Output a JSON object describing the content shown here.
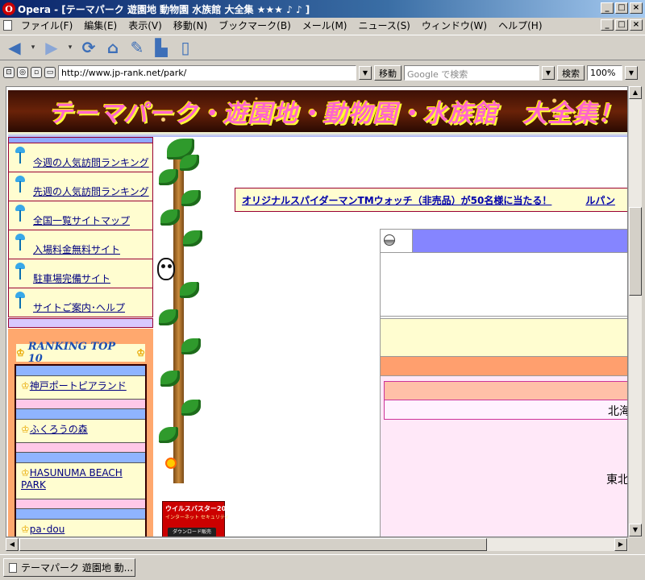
{
  "window": {
    "title": "Opera - [テーマパーク 遊園地 動物園 水族館 大全集 ★★★ ♪ ♪ ]",
    "buttons": {
      "minimize": "_",
      "maximize": "□",
      "close": "×"
    }
  },
  "menubar": {
    "items": [
      "ファイル(F)",
      "編集(E)",
      "表示(V)",
      "移動(N)",
      "ブックマーク(B)",
      "メール(M)",
      "ニュース(S)",
      "ウィンドウ(W)",
      "ヘルプ(H)"
    ]
  },
  "toolbar": {
    "icons": [
      "back-icon",
      "forward-icon",
      "reload-icon",
      "home-icon",
      "hotlist-icon",
      "print-icon",
      "page-icon"
    ]
  },
  "addressbar": {
    "url": "http://www.jp-rank.net/park/",
    "go_label": "移動",
    "search_placeholder": "Google で検索",
    "search_label": "検索",
    "zoom": "100%"
  },
  "page": {
    "banner_title": "テーマパーク・遊園地・動物園・水族館　大全集！",
    "side_menu": [
      "今週の人気訪問ランキング",
      "先週の人気訪問ランキング",
      "全国一覧サイトマップ",
      "入場料金無料サイト",
      "駐車場完備サイト",
      "サイトご案内･ヘルプ"
    ],
    "ranking_title": "RANKING TOP 10",
    "ranking": [
      "神戸ポートピアランド",
      "ふくろうの森",
      "HASUNUMA BEACH PARK",
      "pa･dou"
    ],
    "ad": {
      "title": "ウイルスバスター2004",
      "subtitle": "インターネット セキュリティ",
      "download": "ダウンロード販売"
    },
    "marquee": "オリジナルスパイダーマンTMウォッチ（非売品）が50名様に当たる！",
    "marquee_next": "ルパン",
    "regions": [
      "北海",
      "東北"
    ]
  },
  "status": {
    "tab_title": "テーマパーク 遊園地 動..."
  },
  "colors": {
    "title_bar": "#0a246a",
    "banner_text": "#ff66cc",
    "side_bg": "#fffdd0",
    "link": "#000080",
    "rank_bg": "#ffa86e",
    "content_blue": "#8585ff"
  }
}
